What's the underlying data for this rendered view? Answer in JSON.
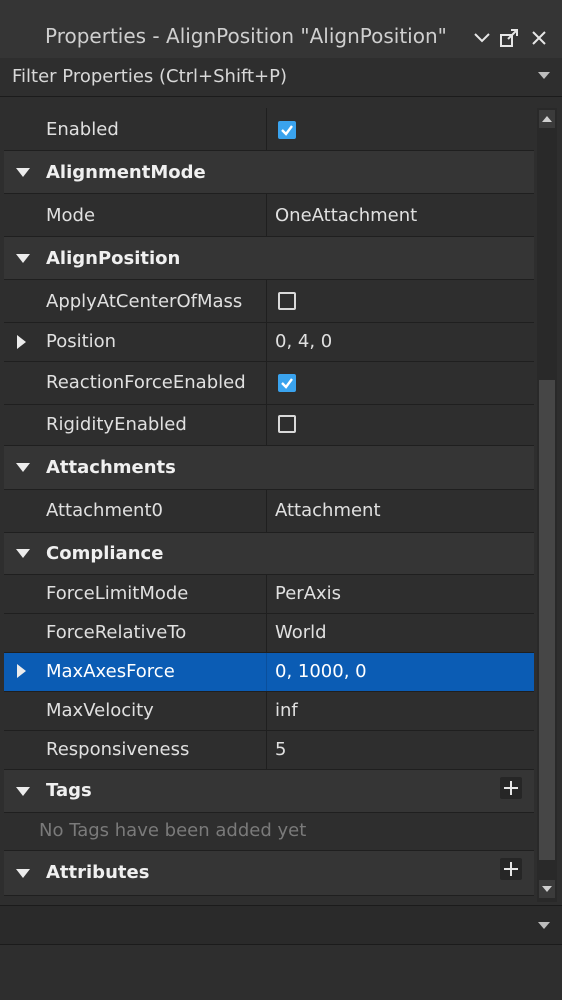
{
  "window": {
    "title": "Properties - AlignPosition \"AlignPosition\""
  },
  "filter": {
    "placeholder": "Filter Properties (Ctrl+Shift+P)"
  },
  "rows": {
    "enabled": {
      "name": "Enabled",
      "checked": true
    },
    "alignment_mode": {
      "name": "AlignmentMode"
    },
    "mode": {
      "name": "Mode",
      "value": "OneAttachment"
    },
    "align_position": {
      "name": "AlignPosition"
    },
    "apply_center": {
      "name": "ApplyAtCenterOfMass",
      "checked": false
    },
    "position": {
      "name": "Position",
      "value": "0, 4, 0"
    },
    "reaction": {
      "name": "ReactionForceEnabled",
      "checked": true
    },
    "rigidity": {
      "name": "RigidityEnabled",
      "checked": false
    },
    "attachments": {
      "name": "Attachments"
    },
    "attachment0": {
      "name": "Attachment0",
      "value": "Attachment"
    },
    "compliance": {
      "name": "Compliance"
    },
    "force_limit_mode": {
      "name": "ForceLimitMode",
      "value": "PerAxis"
    },
    "force_relative": {
      "name": "ForceRelativeTo",
      "value": "World"
    },
    "max_axes_force": {
      "name": "MaxAxesForce",
      "value": "0, 1000, 0"
    },
    "max_velocity": {
      "name": "MaxVelocity",
      "value": "inf"
    },
    "responsiveness": {
      "name": "Responsiveness",
      "value": "5"
    },
    "tags": {
      "name": "Tags",
      "empty_text": "No Tags have been added yet"
    },
    "attributes": {
      "name": "Attributes"
    }
  },
  "colors": {
    "accent": "#3aa3ee",
    "selection": "#0b5cb4",
    "panel": "#2e2e2e",
    "category": "#353535"
  }
}
